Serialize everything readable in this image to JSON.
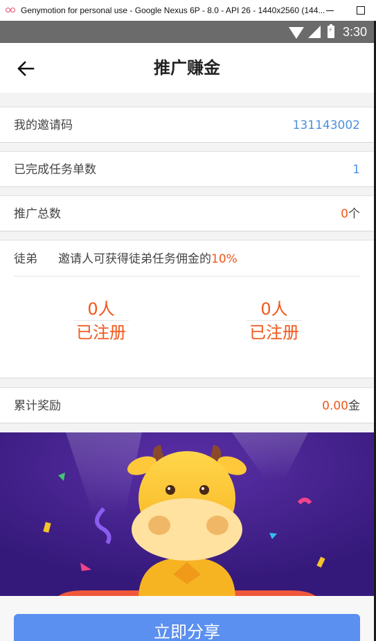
{
  "window": {
    "title": "Genymotion for personal use - Google Nexus 6P - 8.0 - API 26 - 1440x2560 (144..."
  },
  "status_bar": {
    "time": "3:30"
  },
  "header": {
    "title": "推广赚金"
  },
  "rows": {
    "invite_code": {
      "label": "我的邀请码",
      "value": "131143002"
    },
    "completed_tasks": {
      "label": "已完成任务单数",
      "value": "1"
    },
    "promotion_total": {
      "label": "推广总数",
      "value": "0",
      "unit": "个"
    }
  },
  "disciple": {
    "label": "徒弟",
    "desc": "邀请人可获得徒弟任务佣金的",
    "percent": "10%",
    "stats": [
      {
        "count": "0人",
        "caption": "已注册"
      },
      {
        "count": "0人",
        "caption": "已注册"
      }
    ]
  },
  "reward": {
    "label": "累计奖励",
    "value": "0.00",
    "unit": "金"
  },
  "share": {
    "label": "立即分享"
  },
  "colors": {
    "accent_orange": "#f0571b",
    "accent_blue": "#4a90e2",
    "share_button": "#5b8ff0",
    "banner_bg": "#3c1d80"
  },
  "icons": {
    "back": "arrow-left-icon",
    "wifi": "wifi-icon",
    "signal": "signal-icon",
    "battery": "battery-icon",
    "mascot": "cow-mascot"
  }
}
